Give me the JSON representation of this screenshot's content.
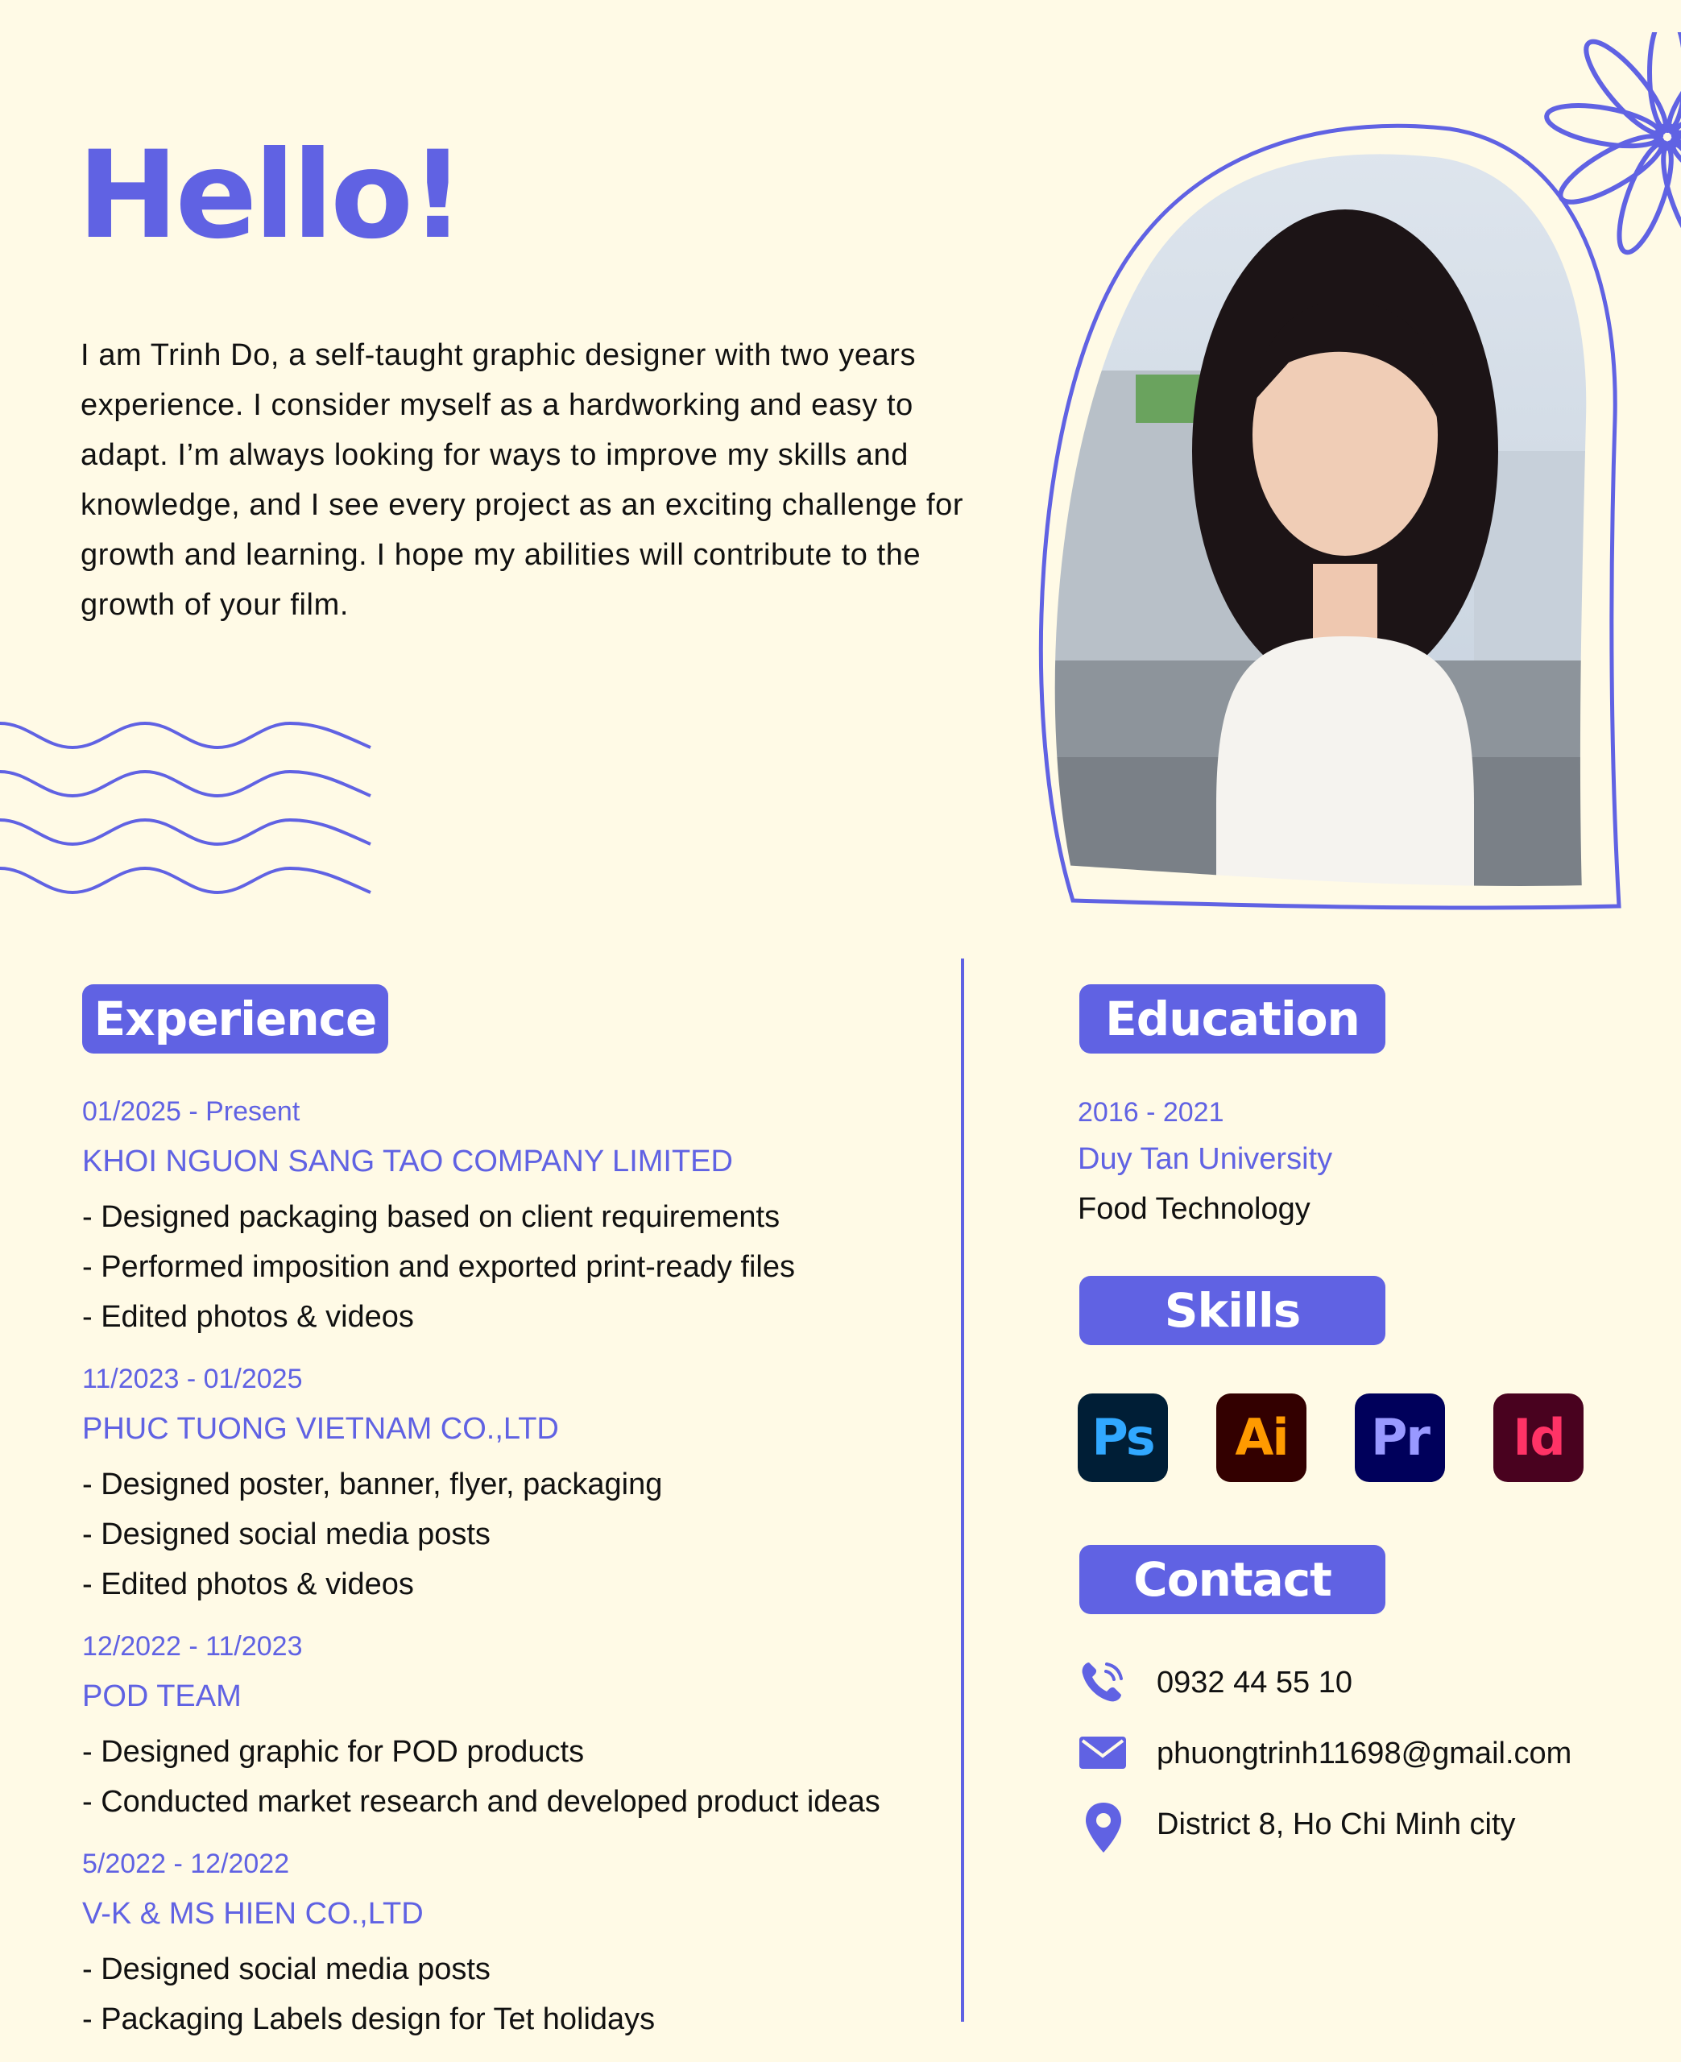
{
  "header": {
    "greeting": "Hello!",
    "intro": "I am Trinh Do, a self-taught graphic designer with two years experience. I consider myself as a hardworking and easy to adapt. I’m always looking for ways to improve my skills and knowledge, and I see every project as an exciting challenge for growth and learning. I hope my abilities will contribute to the growth of your film."
  },
  "experience": {
    "title": "Experience",
    "jobs": [
      {
        "date": "01/2025 - Present",
        "company": "KHOI NGUON SANG TAO COMPANY LIMITED",
        "bullets": [
          "- Designed packaging based on client requirements",
          "- Performed imposition and exported print-ready files",
          "- Edited photos & videos"
        ]
      },
      {
        "date": "11/2023 - 01/2025",
        "company": "PHUC TUONG VIETNAM CO.,LTD",
        "bullets": [
          "- Designed poster, banner, flyer, packaging",
          "- Designed social media posts",
          "- Edited photos & videos"
        ]
      },
      {
        "date": "12/2022 - 11/2023",
        "company": "POD TEAM",
        "bullets": [
          "- Designed graphic for POD products",
          "- Conducted market research and developed product ideas"
        ]
      },
      {
        "date": "5/2022 - 12/2022",
        "company": "V-K & MS HIEN CO.,LTD",
        "bullets": [
          "- Designed social media posts",
          "- Packaging Labels design for Tet holidays"
        ]
      }
    ]
  },
  "education": {
    "title": "Education",
    "date": "2016 - 2021",
    "school": "Duy Tan University",
    "major": "Food Technology"
  },
  "skills": {
    "title": "Skills",
    "items": [
      {
        "label": "Ps",
        "bg": "#001e36",
        "fg": "#31a8ff"
      },
      {
        "label": "Ai",
        "bg": "#330000",
        "fg": "#ff9a00"
      },
      {
        "label": "Pr",
        "bg": "#00005b",
        "fg": "#9999ff"
      },
      {
        "label": "Id",
        "bg": "#49021f",
        "fg": "#ff3366"
      }
    ]
  },
  "contact": {
    "title": "Contact",
    "phone": "0932 44 55 10",
    "email": "phuongtrinh11698@gmail.com",
    "address": "District 8, Ho Chi Minh city",
    "icons": [
      "phone-icon",
      "mail-icon",
      "location-pin-icon"
    ]
  },
  "colors": {
    "accent": "#6062e3",
    "background": "#fffae6",
    "text": "#111111"
  }
}
